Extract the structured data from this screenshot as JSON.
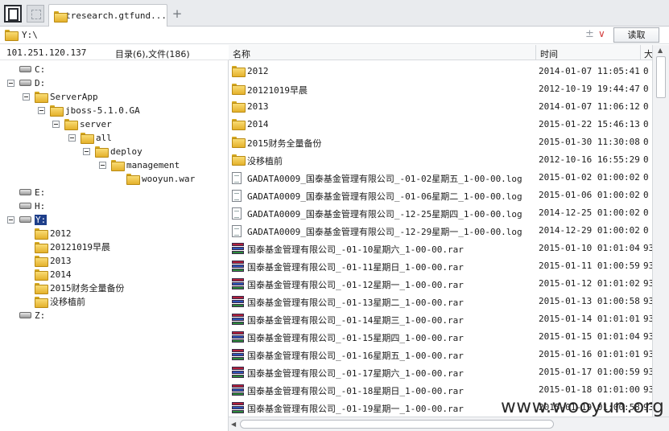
{
  "tabs": {
    "active_label": "gtresearch.gtfund...",
    "add": "+"
  },
  "address": {
    "path": "Y:\\",
    "pm": "±",
    "dropdown": "∨",
    "read_button": "读取"
  },
  "info": {
    "ip": "101.251.120.137",
    "counts": "目录(6),文件(186)"
  },
  "columns": {
    "name": "名称",
    "time": "时间",
    "size": "大"
  },
  "tree": [
    {
      "label": "C:",
      "type": "drive",
      "indent": 0,
      "expander": false
    },
    {
      "label": "D:",
      "type": "drive",
      "indent": 0,
      "expander": true
    },
    {
      "label": "ServerApp",
      "type": "folder",
      "indent": 1,
      "expander": true
    },
    {
      "label": "jboss-5.1.0.GA",
      "type": "folder",
      "indent": 2,
      "expander": true
    },
    {
      "label": "server",
      "type": "folder",
      "indent": 3,
      "expander": true
    },
    {
      "label": "all",
      "type": "folder",
      "indent": 4,
      "expander": true
    },
    {
      "label": "deploy",
      "type": "folder",
      "indent": 5,
      "expander": true
    },
    {
      "label": "management",
      "type": "folder",
      "indent": 6,
      "expander": true
    },
    {
      "label": "wooyun.war",
      "type": "folder",
      "indent": 7,
      "expander": false
    },
    {
      "label": "E:",
      "type": "drive",
      "indent": 0,
      "expander": false
    },
    {
      "label": "H:",
      "type": "drive",
      "indent": 0,
      "expander": false
    },
    {
      "label": "Y:",
      "type": "drive",
      "indent": 0,
      "expander": true,
      "selected": true
    },
    {
      "label": "2012",
      "type": "folder",
      "indent": 1,
      "expander": false
    },
    {
      "label": "20121019早晨",
      "type": "folder",
      "indent": 1,
      "expander": false
    },
    {
      "label": "2013",
      "type": "folder",
      "indent": 1,
      "expander": false
    },
    {
      "label": "2014",
      "type": "folder",
      "indent": 1,
      "expander": false
    },
    {
      "label": "2015财务全量备份",
      "type": "folder",
      "indent": 1,
      "expander": false
    },
    {
      "label": "没移植前",
      "type": "folder",
      "indent": 1,
      "expander": false
    },
    {
      "label": "Z:",
      "type": "drive",
      "indent": 0,
      "expander": false
    }
  ],
  "files": [
    {
      "name": "2012",
      "time": "2014-01-07 11:05:41",
      "size": "0",
      "kind": "folder"
    },
    {
      "name": "20121019早晨",
      "time": "2012-10-19 19:44:47",
      "size": "0",
      "kind": "folder"
    },
    {
      "name": "2013",
      "time": "2014-01-07 11:06:12",
      "size": "0",
      "kind": "folder"
    },
    {
      "name": "2014",
      "time": "2015-01-22 15:46:13",
      "size": "0",
      "kind": "folder"
    },
    {
      "name": "2015财务全量备份",
      "time": "2015-01-30 11:30:08",
      "size": "0",
      "kind": "folder"
    },
    {
      "name": "没移植前",
      "time": "2012-10-16 16:55:29",
      "size": "0",
      "kind": "folder"
    },
    {
      "name": "GADATA0009_国泰基金管理有限公司_-01-02星期五_1-00-00.log",
      "time": "2015-01-02 01:00:02",
      "size": "0",
      "kind": "log"
    },
    {
      "name": "GADATA0009_国泰基金管理有限公司_-01-06星期二_1-00-00.log",
      "time": "2015-01-06 01:00:02",
      "size": "0",
      "kind": "log"
    },
    {
      "name": "GADATA0009_国泰基金管理有限公司_-12-25星期四_1-00-00.log",
      "time": "2014-12-25 01:00:02",
      "size": "0",
      "kind": "log"
    },
    {
      "name": "GADATA0009_国泰基金管理有限公司_-12-29星期一_1-00-00.log",
      "time": "2014-12-29 01:00:02",
      "size": "0",
      "kind": "log"
    },
    {
      "name": "国泰基金管理有限公司_-01-10星期六_1-00-00.rar",
      "time": "2015-01-10 01:01:04",
      "size": "93",
      "kind": "rar"
    },
    {
      "name": "国泰基金管理有限公司_-01-11星期日_1-00-00.rar",
      "time": "2015-01-11 01:00:59",
      "size": "93",
      "kind": "rar"
    },
    {
      "name": "国泰基金管理有限公司_-01-12星期一_1-00-00.rar",
      "time": "2015-01-12 01:01:02",
      "size": "93",
      "kind": "rar"
    },
    {
      "name": "国泰基金管理有限公司_-01-13星期二_1-00-00.rar",
      "time": "2015-01-13 01:00:58",
      "size": "93",
      "kind": "rar"
    },
    {
      "name": "国泰基金管理有限公司_-01-14星期三_1-00-00.rar",
      "time": "2015-01-14 01:01:01",
      "size": "93",
      "kind": "rar"
    },
    {
      "name": "国泰基金管理有限公司_-01-15星期四_1-00-00.rar",
      "time": "2015-01-15 01:01:04",
      "size": "93",
      "kind": "rar"
    },
    {
      "name": "国泰基金管理有限公司_-01-16星期五_1-00-00.rar",
      "time": "2015-01-16 01:01:01",
      "size": "93",
      "kind": "rar"
    },
    {
      "name": "国泰基金管理有限公司_-01-17星期六_1-00-00.rar",
      "time": "2015-01-17 01:00:59",
      "size": "93",
      "kind": "rar"
    },
    {
      "name": "国泰基金管理有限公司_-01-18星期日_1-00-00.rar",
      "time": "2015-01-18 01:01:00",
      "size": "93",
      "kind": "rar"
    },
    {
      "name": "国泰基金管理有限公司_-01-19星期一_1-00-00.rar",
      "time": "2015-01-19 01:00:58",
      "size": "93",
      "kind": "rar"
    }
  ],
  "watermark": "www.wooyun.org"
}
